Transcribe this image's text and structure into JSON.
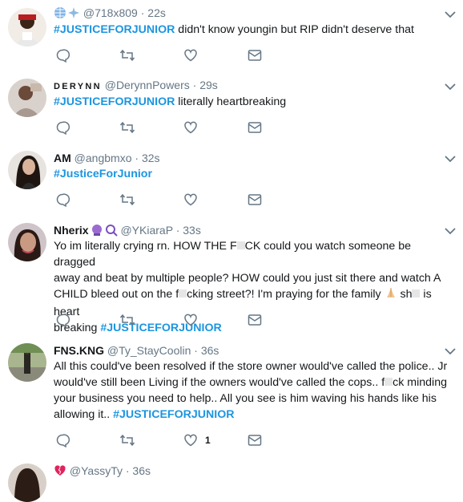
{
  "tweets": [
    {
      "name": "",
      "handle": "@718x809",
      "sep": "·",
      "time": "22s",
      "hashtag": "#JUSTICEFORJUNIOR",
      "text": " didn't know youngin but RIP didn't deserve that"
    },
    {
      "name": "DERYNN",
      "handle": "@DerynnPowers",
      "sep": "·",
      "time": "29s",
      "hashtag": "#JUSTICEFORJUNIOR",
      "text": " literally heartbreaking"
    },
    {
      "name": "AM",
      "handle": "@angbmxo",
      "sep": "·",
      "time": "32s",
      "hashtag": "#JusticeForJunior"
    },
    {
      "name": "Nherix",
      "handle": "@YKiaraP",
      "sep": "·",
      "time": "33s",
      "line1": "Yo im literally crying rn. HOW THE F",
      "line1b": "CK could you watch someone be dragged",
      "line2": "away and beat by multiple people? HOW could you just sit there and watch A",
      "line3a": "CHILD bleed out on the f",
      "line3b": "cking street?! I'm praying for the family ",
      "line3c": " sh",
      "line3d": " is heart",
      "line4a": "breaking ",
      "hashtag": "#JUSTICEFORJUNIOR"
    },
    {
      "name": "FNS.KNG",
      "handle": "@Ty_StayCoolin",
      "sep": "·",
      "time": "36s",
      "line1": "All this could've been resolved if the store owner would've called the police.. Jr",
      "line2": "would've still been Living if the owners would've called the cops.. f",
      "line2b": "ck minding",
      "line3": "your business you need to help.. All you see is him waving his hands like his",
      "line4a": "allowing it.. ",
      "hashtag": "#JUSTICEFORJUNIOR",
      "like_count": "1"
    },
    {
      "handle": "@YassyTy",
      "sep": "·",
      "time": "36s"
    }
  ]
}
